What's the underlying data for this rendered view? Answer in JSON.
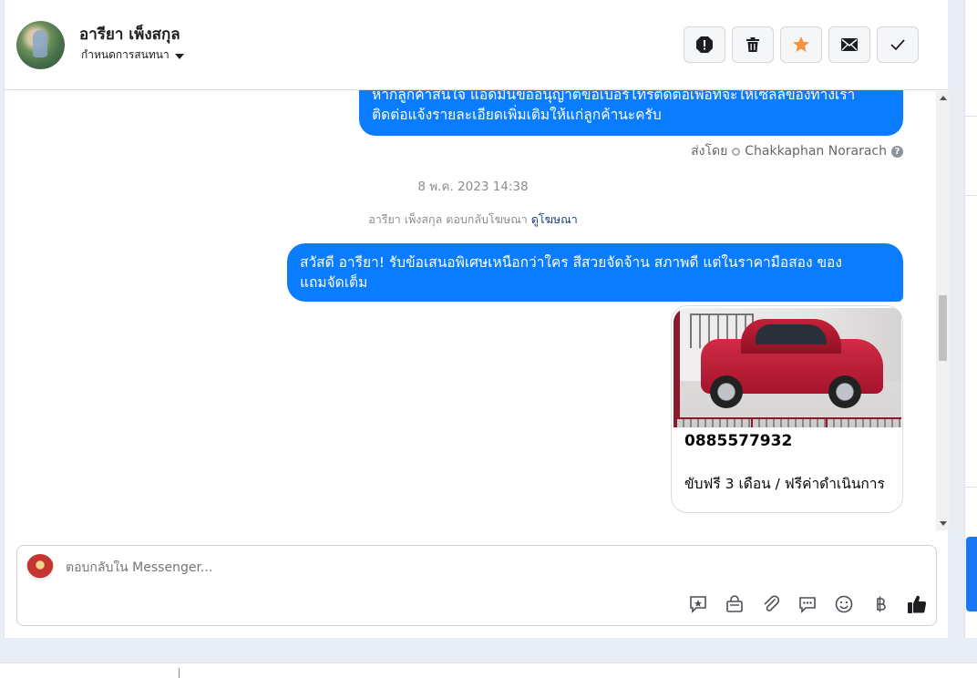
{
  "header": {
    "contact_name": "อารียา เพ็งสกุล",
    "assign_label": "กำหนดการสนทนา",
    "actions": [
      {
        "name": "report-button",
        "icon": "alert-octagon-icon"
      },
      {
        "name": "delete-button",
        "icon": "trash-icon"
      },
      {
        "name": "star-button",
        "icon": "star-icon",
        "color": "#f7923a"
      },
      {
        "name": "mark-unread-button",
        "icon": "envelope-icon"
      },
      {
        "name": "mark-done-button",
        "icon": "check-icon"
      }
    ]
  },
  "messages": {
    "first_bubble_line1": "หากลูกค้าสนใจ แอดมินขออนุญาตขอเบอร์โทรติดต่อเพื่อที่จะให้เซลล์ของทางเรา",
    "first_bubble_line2": "ติดต่อแจ้งรายละเอียดเพิ่มเติมให้แก่ลูกค้านะครับ",
    "sent_by_label": "ส่งโดย",
    "sent_by_name": "Chakkaphan Norarach",
    "timestamp": "8 พ.ค. 2023 14:38",
    "ad_reply_text": "อารียา เพ็งสกุล ตอบกลับโฆษณา",
    "ad_reply_link": "ดูโฆษณา",
    "second_bubble_line1": "สวัสดี อารียา! รับข้อเสนอพิเศษเหนือกว่าใคร สีสวยจัดจ้าน สภาพดี แต่ในราคามือสอง ของ",
    "second_bubble_line2": "แถมจัดเต็ม",
    "card": {
      "title": "0885577932",
      "subtitle": "ขับฟรี 3 เดือน / ฟรีค่าดำเนินการ"
    }
  },
  "composer": {
    "placeholder": "ตอบกลับใน Messenger...",
    "tools": [
      "saved-reply-icon",
      "shop-bag-icon",
      "paperclip-icon",
      "chat-bubble-icon",
      "emoji-icon",
      "baht-icon",
      "thumbs-up-icon"
    ]
  },
  "colors": {
    "accent": "#0a7cff",
    "star": "#f7923a"
  }
}
